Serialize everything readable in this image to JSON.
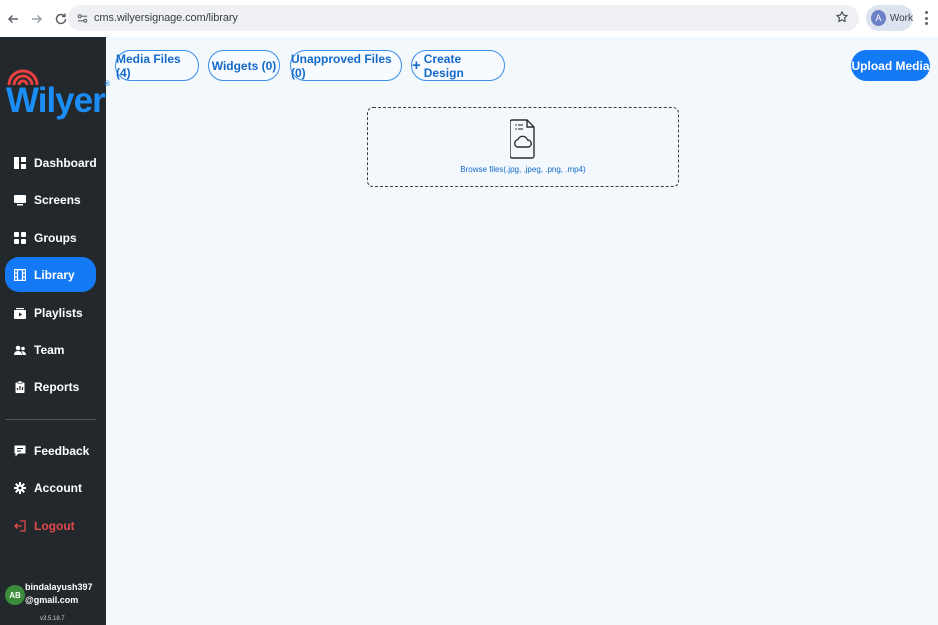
{
  "browser": {
    "url": "cms.wilyersignage.com/library",
    "profile_initial": "A",
    "profile_label": "Work"
  },
  "brand": {
    "name": "Wilyer",
    "trademark": "®",
    "logo_color": "#1b8ef5",
    "arc_color": "#e8413f"
  },
  "sidebar": {
    "items": [
      {
        "label": "Dashboard",
        "icon": "dashboard-icon"
      },
      {
        "label": "Screens",
        "icon": "screen-icon"
      },
      {
        "label": "Groups",
        "icon": "grid-icon"
      },
      {
        "label": "Library",
        "icon": "film-icon",
        "active": true
      },
      {
        "label": "Playlists",
        "icon": "playlist-icon"
      },
      {
        "label": "Team",
        "icon": "team-icon"
      },
      {
        "label": "Reports",
        "icon": "clipboard-icon"
      }
    ],
    "bottom_items": [
      {
        "label": "Feedback",
        "icon": "feedback-icon"
      },
      {
        "label": "Account",
        "icon": "gear-icon"
      },
      {
        "label": "Logout",
        "icon": "logout-icon"
      }
    ],
    "user": {
      "initials": "AB",
      "email": "bindalayush397@gmail.com"
    },
    "version": "v3.5.18.7"
  },
  "toolbar": {
    "tabs": [
      {
        "label": "Media Files (4)"
      },
      {
        "label": "Widgets (0)"
      },
      {
        "label": "Unapproved Files (0)"
      },
      {
        "label": "Create Design",
        "prefix": "+"
      }
    ],
    "upload_label": "Upload Media"
  },
  "dropzone": {
    "label": "Browse files(.jpg, .jpeg, .png, .mp4)"
  },
  "colors": {
    "accent": "#1479f5",
    "sidebar_bg": "#23282d",
    "page_bg": "#f3f8fd",
    "logout": "#e04a4a"
  }
}
